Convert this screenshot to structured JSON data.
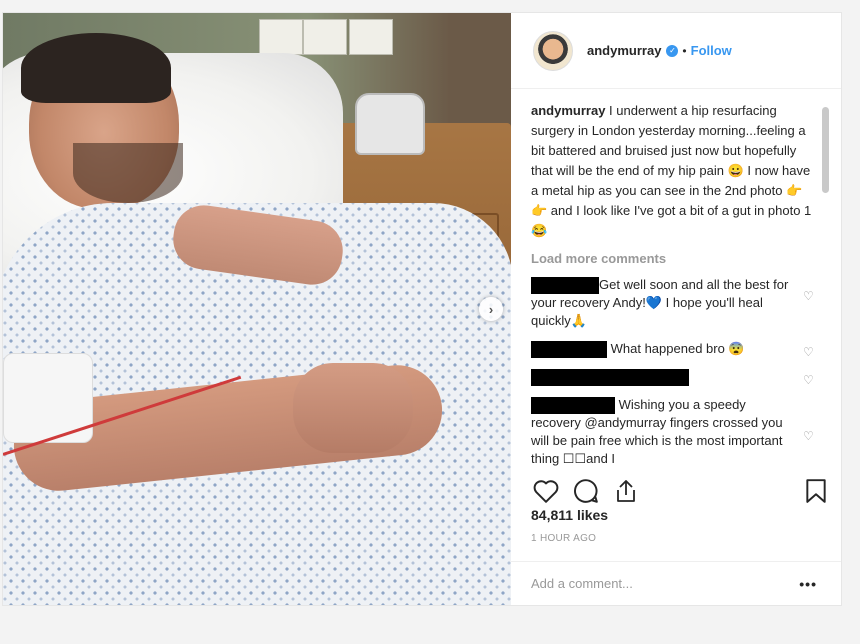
{
  "header": {
    "username": "andymurray",
    "follow_label": "Follow",
    "dot": "•"
  },
  "caption": {
    "username": "andymurray",
    "text": "I underwent a hip resurfacing surgery in London yesterday morning...feeling a bit battered and bruised just now but hopefully that will be the end of my hip pain 😀 I now have a metal hip as you can see in the 2nd photo 👉👉 and I look like I've got a bit of a gut in photo 1😂"
  },
  "load_more": "Load more comments",
  "comments": [
    {
      "text": "Get well soon and all the best for your recovery Andy!💙 I hope you'll heal quickly🙏"
    },
    {
      "text": "What happened bro 😨"
    },
    {
      "text": ""
    },
    {
      "text": "Wishing you a speedy recovery @andymurray fingers crossed you will be pain free which is the most important thing ☐☐and I"
    }
  ],
  "likes": "84,811 likes",
  "time": "1 HOUR AGO",
  "add_comment_placeholder": "Add a comment...",
  "more_label": "•••",
  "icons": {
    "next": "chevron-right-icon",
    "like": "heart-icon",
    "comment": "comment-icon",
    "share": "share-icon",
    "save": "bookmark-icon"
  },
  "colors": {
    "link": "#3897f0",
    "muted": "#999999",
    "text": "#262626"
  }
}
